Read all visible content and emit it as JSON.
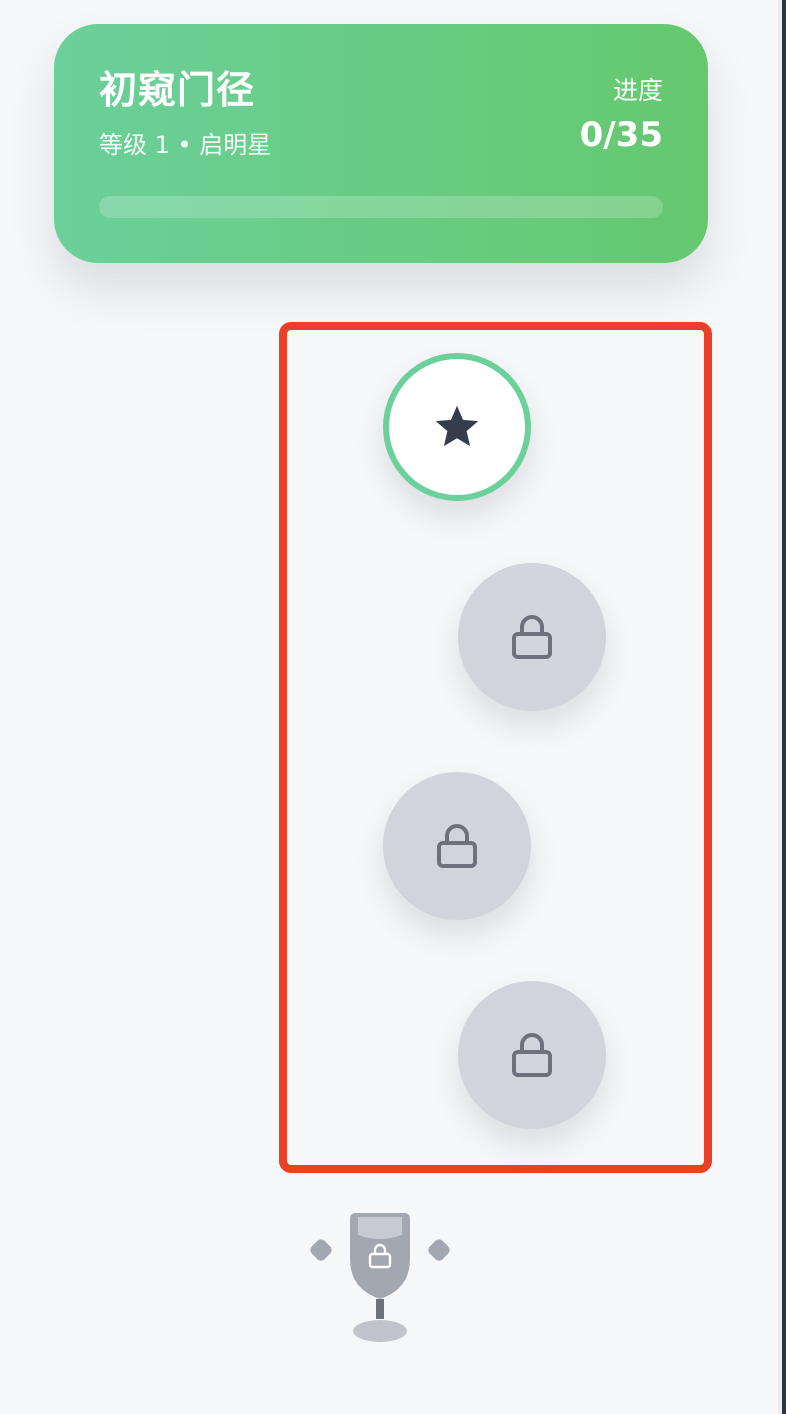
{
  "level_card": {
    "title": "初窥门径",
    "subtitle": "等级 1 • 启明星",
    "progress_label": "进度",
    "progress_value": "0/35",
    "progress_fraction": 0,
    "gradient_start": "#6bd09a",
    "gradient_end": "#66c86e"
  },
  "path": {
    "nodes": [
      {
        "state": "current",
        "icon": "star-icon"
      },
      {
        "state": "locked",
        "icon": "lock-icon"
      },
      {
        "state": "locked",
        "icon": "lock-icon"
      },
      {
        "state": "locked",
        "icon": "lock-icon"
      }
    ],
    "reward": {
      "state": "locked",
      "icon": "trophy-icon"
    }
  },
  "colors": {
    "highlight_frame": "#ec3f27",
    "locked_node": "#d1d4db",
    "lock_icon": "#6d717c",
    "active_ring": "#6bd09a",
    "star": "#353c4c",
    "background": "#f6f7f9"
  }
}
